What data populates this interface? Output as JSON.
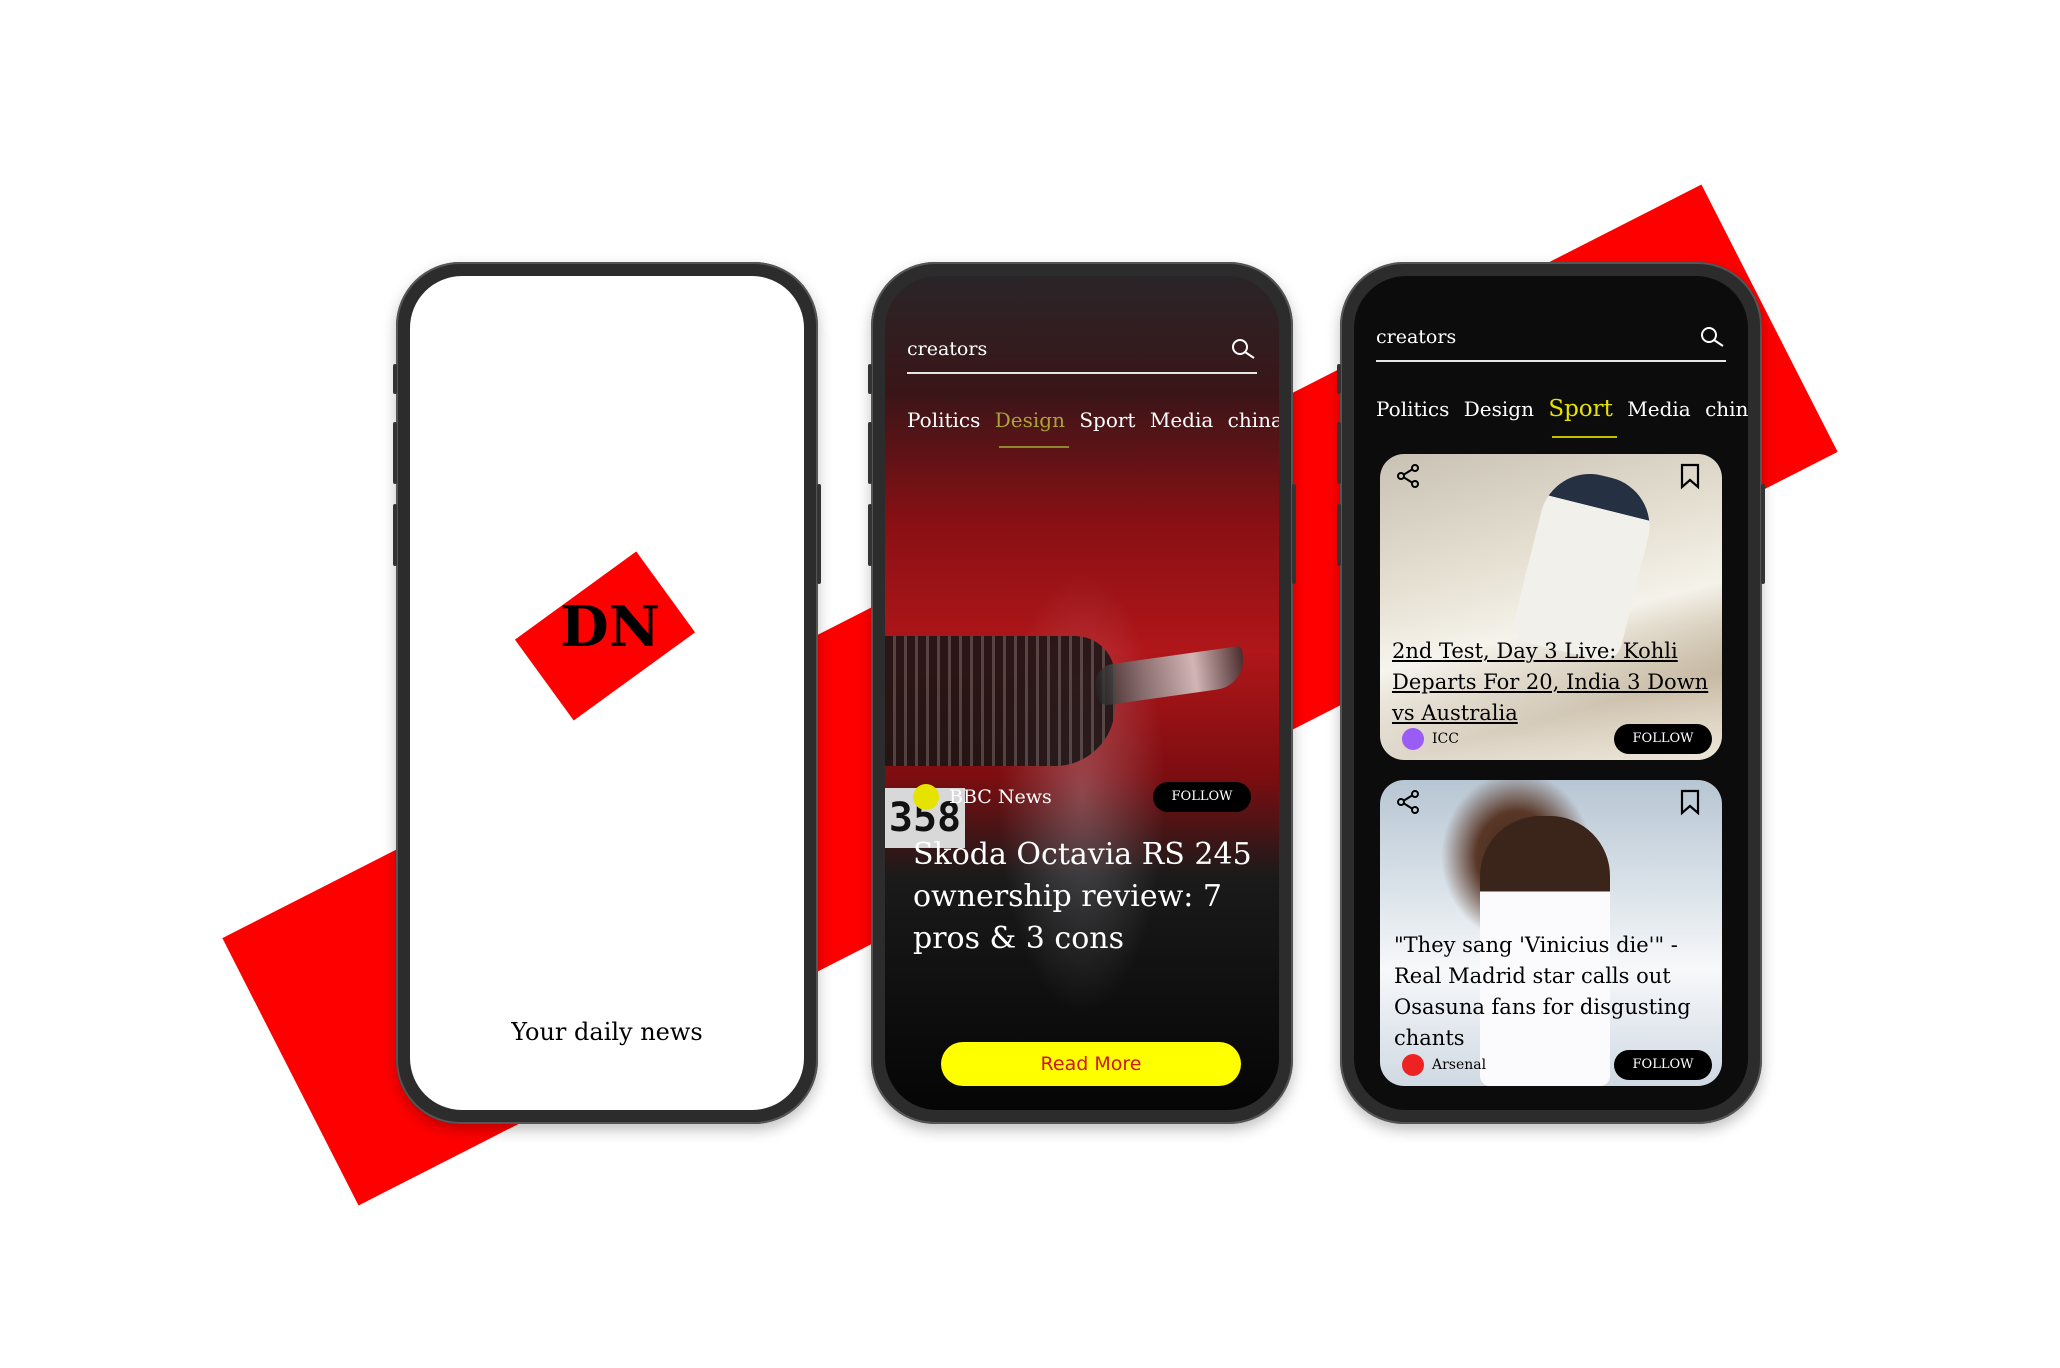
{
  "brand": {
    "logo": "DN",
    "tagline": "Your daily news",
    "accent": "#ff0000"
  },
  "feature": {
    "search": {
      "text": "creators",
      "icon": "search-icon"
    },
    "tabs": [
      {
        "label": "Politics",
        "active": false
      },
      {
        "label": "Design",
        "active": true
      },
      {
        "label": "Sport",
        "active": false
      },
      {
        "label": "Media",
        "active": false
      },
      {
        "label": "china",
        "active": false
      }
    ],
    "plate_text": "358",
    "source": {
      "name": "BBC News",
      "dot_color": "#e6e300"
    },
    "follow_label": "FOLLOW",
    "headline": "Skoda Octavia RS 245 ownership review: 7 pros & 3 cons",
    "read_more_label": "Read More",
    "button_color": "#ffff00"
  },
  "feed": {
    "search": {
      "text": "creators",
      "icon": "search-icon"
    },
    "tabs": [
      {
        "label": "Politics",
        "active": false
      },
      {
        "label": "Design",
        "active": false
      },
      {
        "label": "Sport",
        "active": true
      },
      {
        "label": "Media",
        "active": false
      },
      {
        "label": "china",
        "active": false
      }
    ],
    "cards": [
      {
        "title": "2nd Test, Day 3 Live: Kohli Departs For 20, India 3 Down vs Australia",
        "source": "ICC",
        "dot_color": "#9b5cf5",
        "follow_label": "FOLLOW",
        "icons": [
          "share-icon",
          "bookmark-icon"
        ]
      },
      {
        "title": "\"They sang 'Vinicius die'\" - Real Madrid star calls out Osasuna fans for disgusting chants",
        "source": "Arsenal",
        "dot_color": "#ee2222",
        "follow_label": "FOLLOW",
        "icons": [
          "share-icon",
          "bookmark-icon"
        ]
      }
    ]
  }
}
